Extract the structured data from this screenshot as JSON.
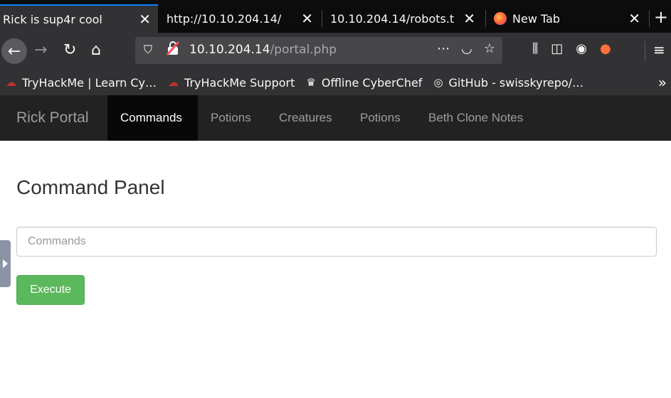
{
  "browser": {
    "tabs": [
      {
        "title": "Rick is sup4r cool",
        "active": true
      },
      {
        "title": "http://10.10.204.14/",
        "active": false
      },
      {
        "title": "10.10.204.14/robots.t",
        "active": false
      },
      {
        "title": "New Tab",
        "active": false
      }
    ],
    "url": {
      "host": "10.10.204.14",
      "path": "/portal.php"
    },
    "bookmarks": [
      {
        "label": "TryHackMe | Learn Cy…",
        "icon": "tryhackme-icon"
      },
      {
        "label": "TryHackMe Support",
        "icon": "tryhackme-icon"
      },
      {
        "label": "Offline CyberChef",
        "icon": "chef-hat-icon"
      },
      {
        "label": "GitHub - swisskyrepo/…",
        "icon": "github-icon"
      }
    ]
  },
  "site": {
    "brand": "Rick Portal",
    "nav": [
      "Commands",
      "Potions",
      "Creatures",
      "Potions",
      "Beth Clone Notes"
    ],
    "active_nav": "Commands"
  },
  "panel": {
    "title": "Command Panel",
    "input_placeholder": "Commands",
    "input_value": "",
    "execute_label": "Execute"
  },
  "colors": {
    "tab_accent": "#0a84ff",
    "site_nav_bg": "#222222",
    "execute_bg": "#5cb85c"
  }
}
